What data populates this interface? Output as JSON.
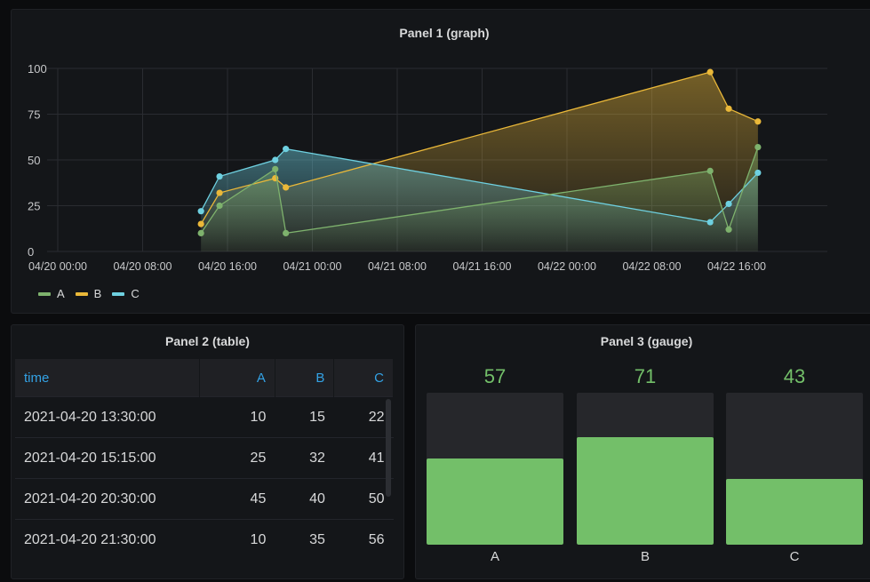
{
  "panel1": {
    "title": "Panel 1 (graph)",
    "legend": [
      {
        "name": "A",
        "color": "#7eb26d"
      },
      {
        "name": "B",
        "color": "#eab839"
      },
      {
        "name": "C",
        "color": "#6ed0e0"
      }
    ]
  },
  "chart_data": {
    "type": "line",
    "title": "Panel 1 (graph)",
    "x_tick_labels": [
      "04/20 00:00",
      "04/20 08:00",
      "04/20 16:00",
      "04/21 00:00",
      "04/21 08:00",
      "04/21 16:00",
      "04/22 00:00",
      "04/22 08:00",
      "04/22 16:00"
    ],
    "y_ticks": [
      0,
      25,
      50,
      75,
      100
    ],
    "ylim": [
      0,
      100
    ],
    "grid": true,
    "legend_position": "bottom-left",
    "series": [
      {
        "name": "A",
        "color": "#7eb26d",
        "points": [
          [
            "2021-04-20 13:30",
            10
          ],
          [
            "2021-04-20 15:15",
            25
          ],
          [
            "2021-04-20 20:30",
            45
          ],
          [
            "2021-04-20 21:30",
            10
          ],
          [
            "2021-04-22 13:30",
            44
          ],
          [
            "2021-04-22 15:15",
            12
          ],
          [
            "2021-04-22 18:00",
            57
          ]
        ]
      },
      {
        "name": "B",
        "color": "#eab839",
        "points": [
          [
            "2021-04-20 13:30",
            15
          ],
          [
            "2021-04-20 15:15",
            32
          ],
          [
            "2021-04-20 20:30",
            40
          ],
          [
            "2021-04-20 21:30",
            35
          ],
          [
            "2021-04-22 13:30",
            98
          ],
          [
            "2021-04-22 15:15",
            78
          ],
          [
            "2021-04-22 18:00",
            71
          ]
        ]
      },
      {
        "name": "C",
        "color": "#6ed0e0",
        "points": [
          [
            "2021-04-20 13:30",
            22
          ],
          [
            "2021-04-20 15:15",
            41
          ],
          [
            "2021-04-20 20:30",
            50
          ],
          [
            "2021-04-20 21:30",
            56
          ],
          [
            "2021-04-22 13:30",
            16
          ],
          [
            "2021-04-22 15:15",
            26
          ],
          [
            "2021-04-22 18:00",
            43
          ]
        ]
      }
    ]
  },
  "panel2": {
    "title": "Panel 2 (table)",
    "columns": [
      "time",
      "A",
      "B",
      "C"
    ],
    "rows": [
      [
        "2021-04-20 13:30:00",
        "10",
        "15",
        "22"
      ],
      [
        "2021-04-20 15:15:00",
        "25",
        "32",
        "41"
      ],
      [
        "2021-04-20 20:30:00",
        "45",
        "40",
        "50"
      ],
      [
        "2021-04-20 21:30:00",
        "10",
        "35",
        "56"
      ]
    ]
  },
  "panel3": {
    "title": "Panel 3 (gauge)",
    "max": 100,
    "fill_color": "#73bf69",
    "gauges": [
      {
        "label": "A",
        "value": "57"
      },
      {
        "label": "B",
        "value": "71"
      },
      {
        "label": "C",
        "value": "43"
      }
    ]
  }
}
